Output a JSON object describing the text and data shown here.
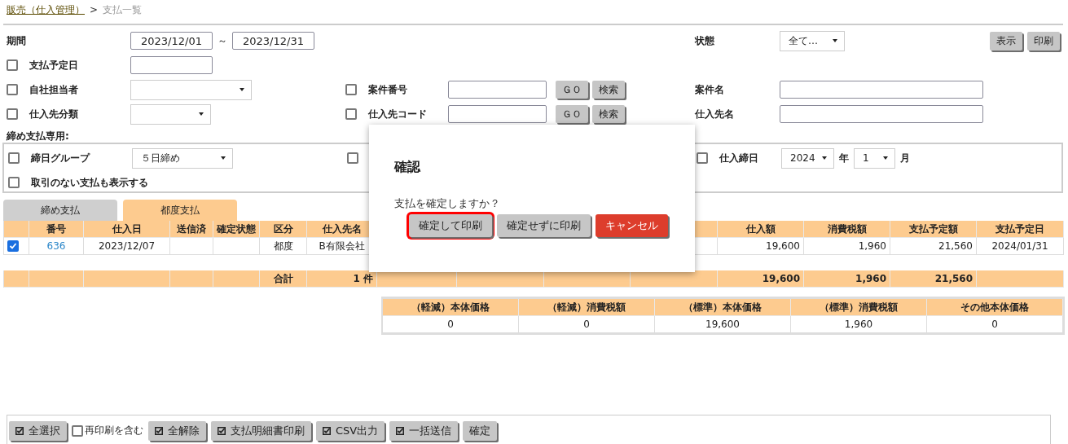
{
  "breadcrumb": {
    "parent": "販売（仕入管理）",
    "separator": ">",
    "current": "支払一覧"
  },
  "filters": {
    "period": {
      "label": "期間",
      "from": "2023/12/01",
      "separator": "～",
      "to": "2023/12/31"
    },
    "status": {
      "label": "状態",
      "value": "全て…"
    },
    "actions": [
      "表示",
      "印刷"
    ],
    "due_date": {
      "label": "支払予定日",
      "checked": false
    },
    "staff": {
      "label": "自社担当者",
      "checked": false
    },
    "supplier_class": {
      "label": "仕入先分類",
      "checked": false
    },
    "case_number": {
      "label": "案件番号",
      "checked": false,
      "buttons": [
        "ＧＯ",
        "検索"
      ]
    },
    "supplier_code": {
      "label": "仕入先コード",
      "checked": false,
      "buttons": [
        "ＧＯ",
        "検索"
      ]
    },
    "case_name": {
      "label": "案件名"
    },
    "supplier_name": {
      "label": "仕入先名"
    }
  },
  "closing": {
    "title": "締め支払専用:",
    "group": {
      "label": "締日グループ",
      "checked": false,
      "value": "５日締め"
    },
    "covered_option": {
      "checked": false
    },
    "closing_date": {
      "label": "仕入締日",
      "checked": false,
      "year": "2024",
      "year_unit": "年",
      "month": "1",
      "month_unit": "月"
    },
    "show_empty": {
      "label": "取引のない支払も表示する",
      "checked": false
    }
  },
  "tabs": [
    {
      "label": "締め支払",
      "selected": false
    },
    {
      "label": "都度支払",
      "selected": true
    }
  ],
  "table": {
    "columns": [
      "番号",
      "仕入日",
      "送信済",
      "確定状態",
      "区分",
      "仕入先名",
      "仕入額",
      "消費税額",
      "支払予定額",
      "支払予定日"
    ],
    "rows": [
      {
        "selected": true,
        "number": "636",
        "date": "2023/12/07",
        "category": "都度",
        "supplier": "B有限会社",
        "amount": "19,600",
        "tax": "1,960",
        "payment": "21,560",
        "due": "2024/01/31"
      }
    ],
    "total": {
      "label": "合計",
      "count": "1 件",
      "amount": "19,600",
      "tax": "1,960",
      "payment": "21,560"
    }
  },
  "tax_summary": {
    "columns": [
      "（軽減）本体価格",
      "（軽減）消費税額",
      "（標準）本体価格",
      "（標準）消費税額",
      "その他本体価格"
    ],
    "values": [
      "0",
      "0",
      "19,600",
      "1,960",
      "0"
    ]
  },
  "dialog": {
    "title": "確認",
    "message": "支払を確定しますか？",
    "buttons": [
      {
        "label": "確定して印刷",
        "kind": "default",
        "focused": true
      },
      {
        "label": "確定せずに印刷",
        "kind": "default",
        "focused": false
      },
      {
        "label": "キャンセル",
        "kind": "danger",
        "focused": false
      }
    ]
  },
  "toolbar": [
    {
      "kind": "button",
      "label": "全選択",
      "icon": true
    },
    {
      "kind": "checkbox",
      "label": "再印刷を含む",
      "checked": false
    },
    {
      "kind": "button",
      "label": "全解除",
      "icon": true
    },
    {
      "kind": "button",
      "label": "支払明細書印刷",
      "icon": true
    },
    {
      "kind": "button",
      "label": "CSV出力",
      "icon": true
    },
    {
      "kind": "button",
      "label": "一括送信",
      "icon": true
    },
    {
      "kind": "button",
      "label": "確定",
      "icon": false
    }
  ]
}
